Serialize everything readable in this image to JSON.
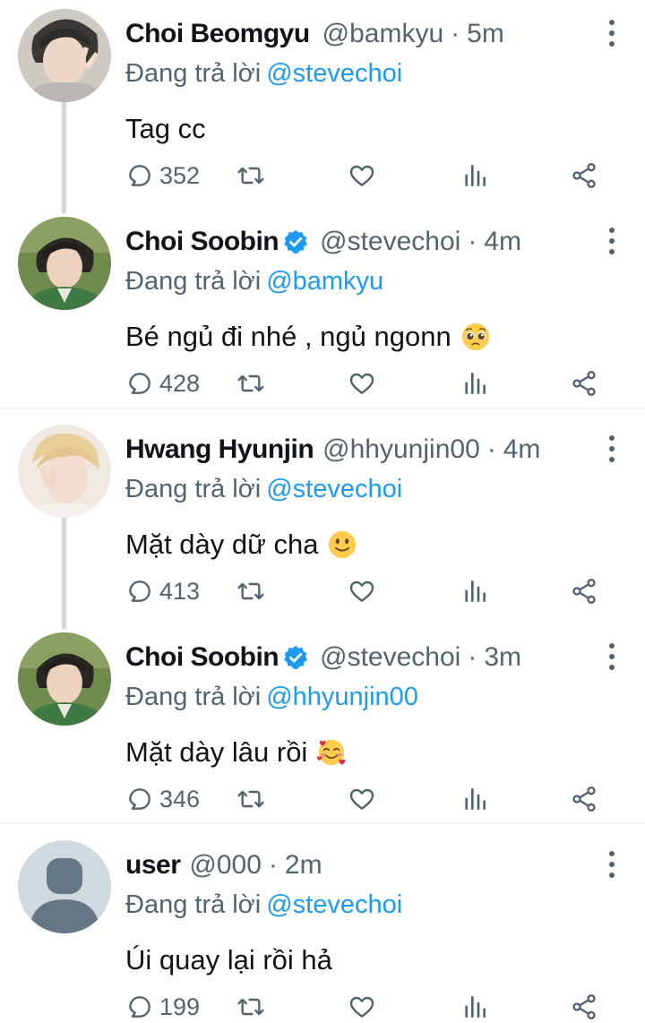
{
  "colors": {
    "accent": "#1d9bf0",
    "secondary_text": "#536471",
    "primary_text": "#0f1419",
    "thread_line": "#cfd9de",
    "divider": "#eff3f4"
  },
  "reply_prefix": "Đang trả lời",
  "tweets": [
    {
      "name": "Choi Beomgyu",
      "verified": false,
      "handle": "@bamkyu",
      "time": "5m",
      "reply_to": "@stevechoi",
      "text": "Tag cc",
      "emoji": "",
      "replies": "352",
      "avatar": "photo"
    },
    {
      "name": "Choi Soobin",
      "verified": true,
      "handle": "@stevechoi",
      "time": "4m",
      "reply_to": "@bamkyu",
      "text": "Bé ngủ đi nhé , ngủ ngonn",
      "emoji": "pleading-face",
      "replies": "428",
      "avatar": "photo"
    },
    {
      "name": "Hwang Hyunjin",
      "verified": false,
      "handle": "@hhyunjin00",
      "time": "4m",
      "reply_to": "@stevechoi",
      "text": "Mặt dày dữ cha",
      "emoji": "slightly-smiling-face",
      "replies": "413",
      "avatar": "photo"
    },
    {
      "name": "Choi Soobin",
      "verified": true,
      "handle": "@stevechoi",
      "time": "3m",
      "reply_to": "@hhyunjin00",
      "text": "Mặt dày lâu rồi",
      "emoji": "smiling-face-with-hearts",
      "replies": "346",
      "avatar": "photo"
    },
    {
      "name": "user",
      "verified": false,
      "handle": "@000",
      "time": "2m",
      "reply_to": "@stevechoi",
      "text": "Úi quay lại rồi hả",
      "emoji": "",
      "replies": "199",
      "avatar": "default-avatar-icon"
    }
  ]
}
